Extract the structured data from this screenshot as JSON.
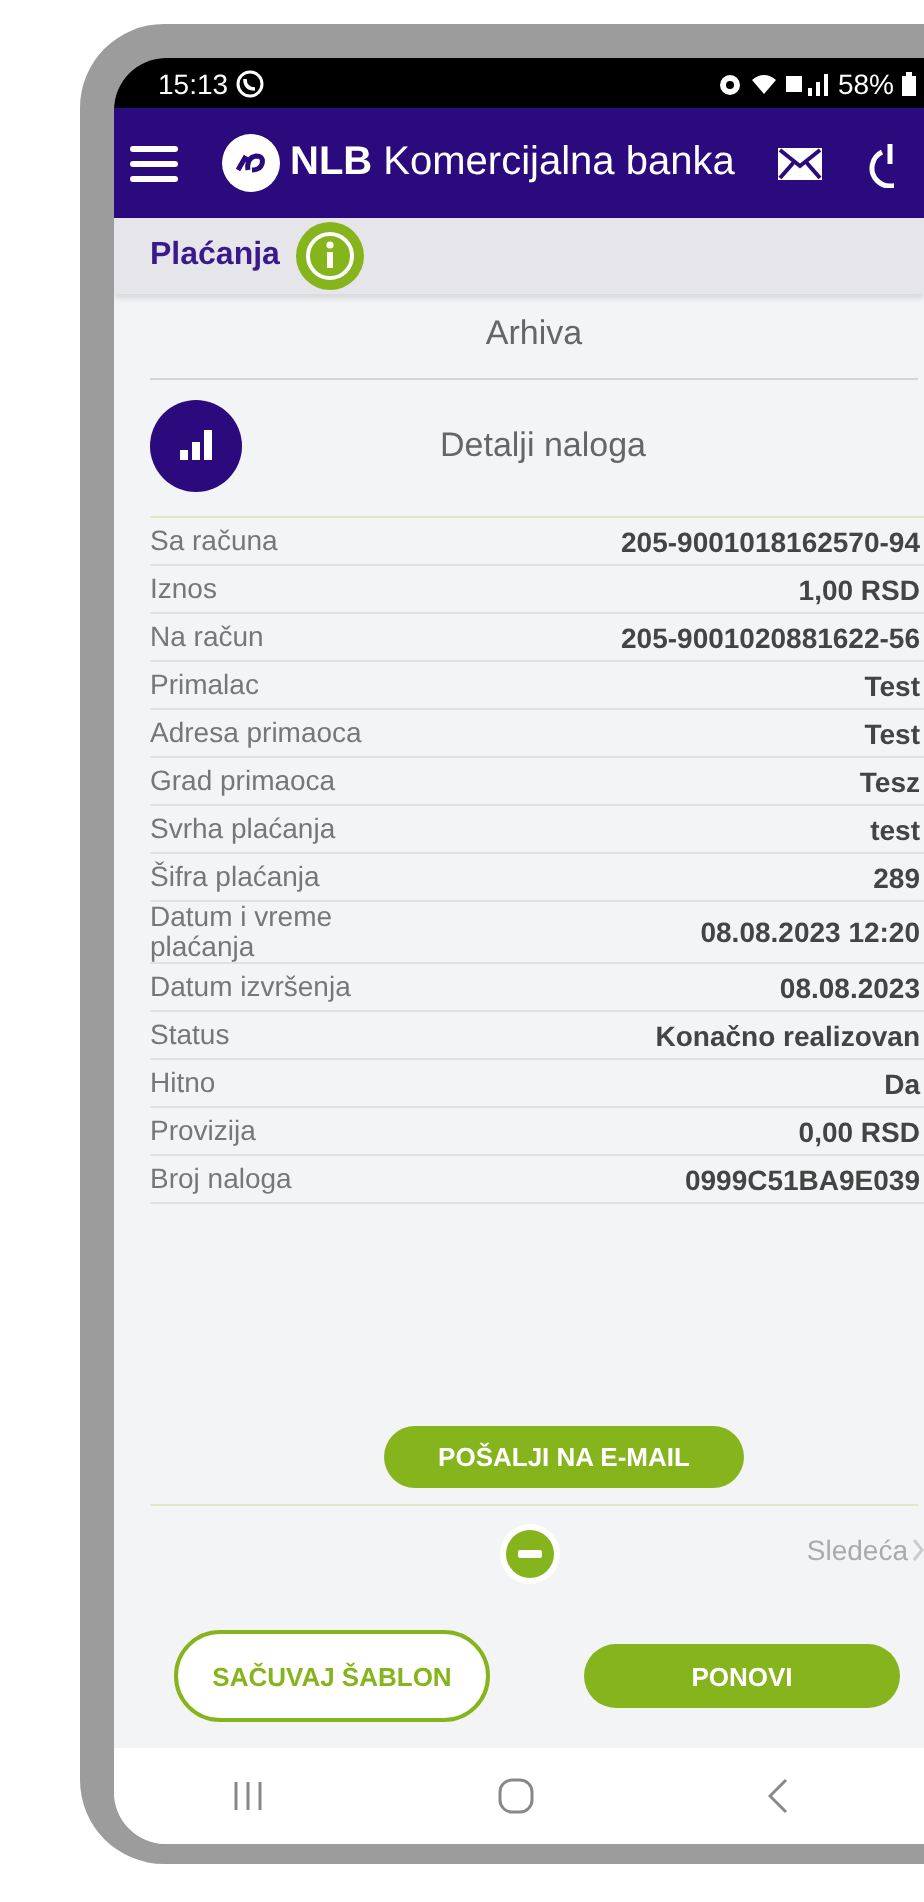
{
  "status_bar": {
    "time": "15:13",
    "battery": "58%"
  },
  "header": {
    "title": "**NLB** Komercijalna banka"
  },
  "section": {
    "title": "Plaćanja"
  },
  "subtitle": "Arhiva",
  "details": {
    "title": "Detalji naloga",
    "rows": [
      {
        "label": "Sa računa",
        "value": "205-9001018162570-94"
      },
      {
        "label": "Iznos",
        "value": "1,00 RSD"
      },
      {
        "label": "Na račun",
        "value": "205-9001020881622-56"
      },
      {
        "label": "Primalac",
        "value": "Test"
      },
      {
        "label": "Adresa primaoca",
        "value": "Test"
      },
      {
        "label": "Grad primaoca",
        "value": "Tesz"
      },
      {
        "label": "Svrha plaćanja",
        "value": "test"
      },
      {
        "label": "Šifra plaćanja",
        "value": "289"
      },
      {
        "label": "Datum i vreme plaćanja",
        "value": "08.08.2023 12:20"
      },
      {
        "label": "Datum izvršenja",
        "value": "08.08.2023"
      },
      {
        "label": "Status",
        "value": "Konačno realizovan"
      },
      {
        "label": "Hitno",
        "value": "Da"
      },
      {
        "label": "Provizija",
        "value": "0,00 RSD"
      },
      {
        "label": "Broj naloga",
        "value": "0999C51BA9E039"
      }
    ]
  },
  "email_button": "POŠALJI NA E-MAIL",
  "next_link": "Sledeća",
  "actions": [
    {
      "label": "SAČUVAJ ŠABLON",
      "kind": "outline"
    },
    {
      "label": "PONOVI",
      "kind": "filled"
    }
  ]
}
